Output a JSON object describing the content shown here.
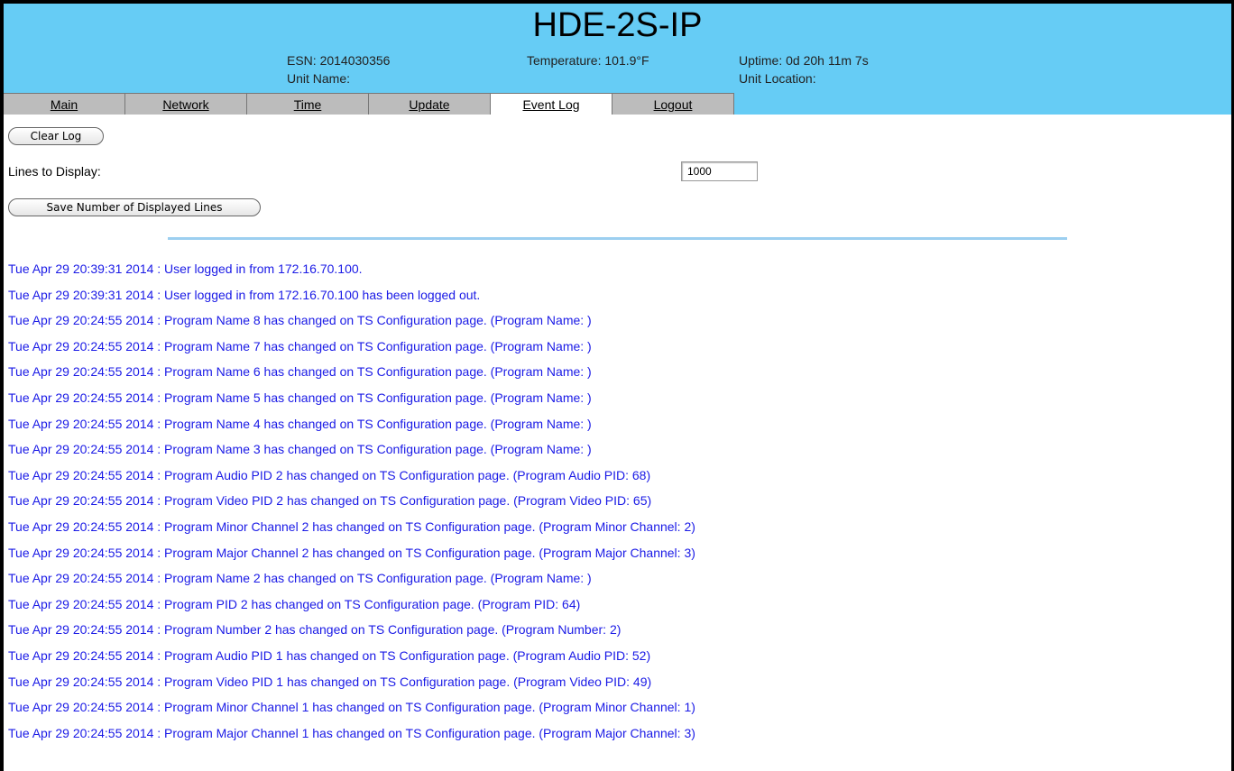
{
  "header": {
    "title": "HDE-2S-IP",
    "esn": "ESN: 2014030356",
    "unit_name": "Unit Name:",
    "temperature": "Temperature: 101.9°F",
    "uptime": "Uptime: 0d 20h 11m 7s",
    "unit_location": "Unit Location:"
  },
  "tabs": [
    {
      "label": "Main"
    },
    {
      "label": "Network"
    },
    {
      "label": "Time"
    },
    {
      "label": "Update"
    },
    {
      "label": "Event Log",
      "active": true
    },
    {
      "label": "Logout"
    }
  ],
  "controls": {
    "clear_log": "Clear Log",
    "lines_label": "Lines to Display:",
    "lines_value": "1000",
    "save_lines": "Save Number of Displayed Lines"
  },
  "log": [
    "Tue Apr 29 20:39:31 2014 : User logged in from 172.16.70.100.",
    "Tue Apr 29 20:39:31 2014 : User logged in from 172.16.70.100 has been logged out.",
    "Tue Apr 29 20:24:55 2014 : Program Name 8 has changed on TS Configuration page. (Program Name: )",
    "Tue Apr 29 20:24:55 2014 : Program Name 7 has changed on TS Configuration page. (Program Name: )",
    "Tue Apr 29 20:24:55 2014 : Program Name 6 has changed on TS Configuration page. (Program Name: )",
    "Tue Apr 29 20:24:55 2014 : Program Name 5 has changed on TS Configuration page. (Program Name: )",
    "Tue Apr 29 20:24:55 2014 : Program Name 4 has changed on TS Configuration page. (Program Name: )",
    "Tue Apr 29 20:24:55 2014 : Program Name 3 has changed on TS Configuration page. (Program Name: )",
    "Tue Apr 29 20:24:55 2014 : Program Audio PID 2 has changed on TS Configuration page. (Program Audio PID: 68)",
    "Tue Apr 29 20:24:55 2014 : Program Video PID 2 has changed on TS Configuration page. (Program Video PID: 65)",
    "Tue Apr 29 20:24:55 2014 : Program Minor Channel 2 has changed on TS Configuration page. (Program Minor Channel: 2)",
    "Tue Apr 29 20:24:55 2014 : Program Major Channel 2 has changed on TS Configuration page. (Program Major Channel: 3)",
    "Tue Apr 29 20:24:55 2014 : Program Name 2 has changed on TS Configuration page. (Program Name: )",
    "Tue Apr 29 20:24:55 2014 : Program PID 2 has changed on TS Configuration page. (Program PID: 64)",
    "Tue Apr 29 20:24:55 2014 : Program Number 2 has changed on TS Configuration page. (Program Number: 2)",
    "Tue Apr 29 20:24:55 2014 : Program Audio PID 1 has changed on TS Configuration page. (Program Audio PID: 52)",
    "Tue Apr 29 20:24:55 2014 : Program Video PID 1 has changed on TS Configuration page. (Program Video PID: 49)",
    "Tue Apr 29 20:24:55 2014 : Program Minor Channel 1 has changed on TS Configuration page. (Program Minor Channel: 1)",
    "Tue Apr 29 20:24:55 2014 : Program Major Channel 1 has changed on TS Configuration page. (Program Major Channel: 3)"
  ],
  "colors": {
    "header_bg": "#66ccf5",
    "tab_bg": "#bcbcbc",
    "log_text": "#1a1ae6",
    "divider": "#9ccff0"
  }
}
